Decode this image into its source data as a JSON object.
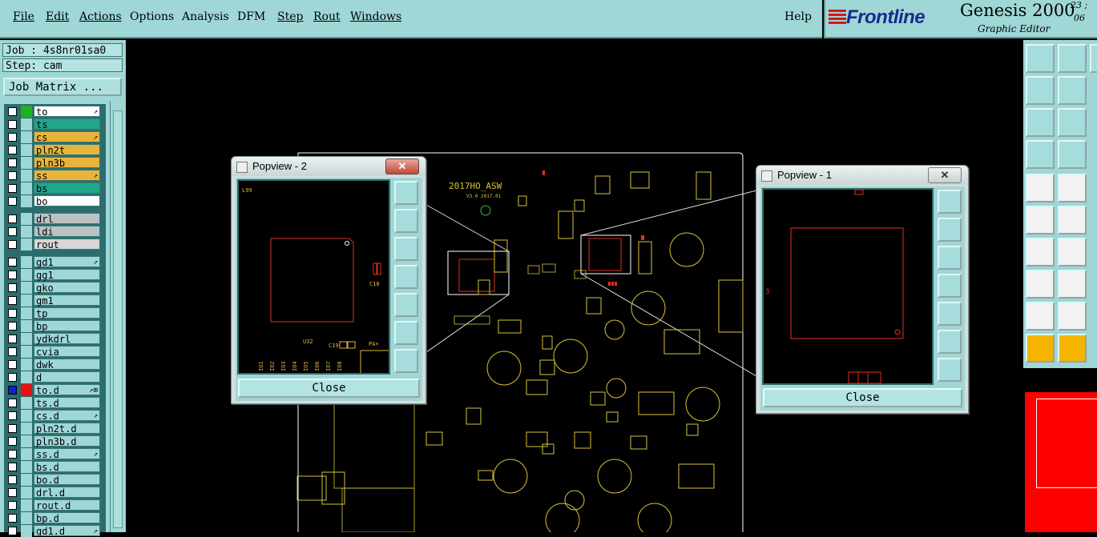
{
  "menu": {
    "items": [
      "File",
      "Edit",
      "Actions",
      "Options",
      "Analysis",
      "DFM",
      "Step",
      "Rout",
      "Windows"
    ],
    "help": "Help"
  },
  "brand": {
    "logo": "Frontline",
    "title": "Genesis 2000",
    "subtitle": "Graphic Editor",
    "clock_line1": "23 ;",
    "clock_line2": "06"
  },
  "job": {
    "job_label": "Job : 4s8nr01sa0",
    "step_label": "Step: cam",
    "matrix_button": "Job Matrix ..."
  },
  "layers": [
    {
      "name": "to",
      "swatch": "#20b020",
      "fill": "#ffffff",
      "mark": "↗"
    },
    {
      "name": "ts",
      "swatch": "#9fd6d6",
      "fill": "#21a68a",
      "mark": ""
    },
    {
      "name": "cs",
      "swatch": "#9fd6d6",
      "fill": "#e8b43a",
      "mark": "↗"
    },
    {
      "name": "pln2t",
      "swatch": "#9fd6d6",
      "fill": "#e8b43a",
      "mark": ""
    },
    {
      "name": "pln3b",
      "swatch": "#9fd6d6",
      "fill": "#e8b43a",
      "mark": ""
    },
    {
      "name": "ss",
      "swatch": "#9fd6d6",
      "fill": "#e8b43a",
      "mark": "↗"
    },
    {
      "name": "bs",
      "swatch": "#9fd6d6",
      "fill": "#21a68a",
      "mark": ""
    },
    {
      "name": "bo",
      "swatch": "#9fd6d6",
      "fill": "#ffffff",
      "mark": ""
    },
    {
      "name": "drl",
      "swatch": "#9fd6d6",
      "fill": "#b9c3c3",
      "mark": ""
    },
    {
      "name": "ldi",
      "swatch": "#9fd6d6",
      "fill": "#b9c3c3",
      "mark": ""
    },
    {
      "name": "rout",
      "swatch": "#9fd6d6",
      "fill": "#d6d6d6",
      "mark": ""
    },
    {
      "name": "gd1",
      "swatch": "#9fd6d6",
      "fill": "#9fd6d6",
      "mark": "↗"
    },
    {
      "name": "gg1",
      "swatch": "#9fd6d6",
      "fill": "#9fd6d6",
      "mark": ""
    },
    {
      "name": "gko",
      "swatch": "#9fd6d6",
      "fill": "#9fd6d6",
      "mark": ""
    },
    {
      "name": "gm1",
      "swatch": "#9fd6d6",
      "fill": "#9fd6d6",
      "mark": ""
    },
    {
      "name": "tp",
      "swatch": "#9fd6d6",
      "fill": "#9fd6d6",
      "mark": ""
    },
    {
      "name": "bp",
      "swatch": "#9fd6d6",
      "fill": "#9fd6d6",
      "mark": ""
    },
    {
      "name": "ydkdrl",
      "swatch": "#9fd6d6",
      "fill": "#9fd6d6",
      "mark": ""
    },
    {
      "name": "cvia",
      "swatch": "#9fd6d6",
      "fill": "#9fd6d6",
      "mark": ""
    },
    {
      "name": "dwk",
      "swatch": "#9fd6d6",
      "fill": "#9fd6d6",
      "mark": ""
    },
    {
      "name": "d",
      "swatch": "#9fd6d6",
      "fill": "#9fd6d6",
      "mark": ""
    },
    {
      "name": "to.d",
      "swatch": "#ee1010",
      "fill": "#9fd6d6",
      "mark": "↗⊞",
      "selected": true
    },
    {
      "name": "ts.d",
      "swatch": "#9fd6d6",
      "fill": "#9fd6d6",
      "mark": ""
    },
    {
      "name": "cs.d",
      "swatch": "#9fd6d6",
      "fill": "#9fd6d6",
      "mark": "↗"
    },
    {
      "name": "pln2t.d",
      "swatch": "#9fd6d6",
      "fill": "#9fd6d6",
      "mark": ""
    },
    {
      "name": "pln3b.d",
      "swatch": "#9fd6d6",
      "fill": "#9fd6d6",
      "mark": ""
    },
    {
      "name": "ss.d",
      "swatch": "#9fd6d6",
      "fill": "#9fd6d6",
      "mark": "↗"
    },
    {
      "name": "bs.d",
      "swatch": "#9fd6d6",
      "fill": "#9fd6d6",
      "mark": ""
    },
    {
      "name": "bo.d",
      "swatch": "#9fd6d6",
      "fill": "#9fd6d6",
      "mark": ""
    },
    {
      "name": "drl.d",
      "swatch": "#9fd6d6",
      "fill": "#9fd6d6",
      "mark": ""
    },
    {
      "name": "rout.d",
      "swatch": "#9fd6d6",
      "fill": "#9fd6d6",
      "mark": ""
    },
    {
      "name": "bp.d",
      "swatch": "#9fd6d6",
      "fill": "#9fd6d6",
      "mark": ""
    },
    {
      "name": "gd1.d",
      "swatch": "#9fd6d6",
      "fill": "#9fd6d6",
      "mark": "↗"
    }
  ],
  "board": {
    "silk_title": "2017HO_ASW",
    "silk_version": "V3.0 2017.01"
  },
  "popview2": {
    "title": "Popview - 2",
    "close": "Close",
    "labels": {
      "l1": "L99",
      "l2": "C18",
      "l3": "U32",
      "l4": "C19",
      "l5": "PA+"
    },
    "pins": [
      "IO1",
      "IO2",
      "IO3",
      "IO4",
      "IO5",
      "IO6",
      "IO7",
      "IO8"
    ]
  },
  "popview1": {
    "title": "Popview - 1",
    "close": "Close",
    "labels": {
      "l1": "3"
    }
  },
  "colors": {
    "panel": "#9fd6d6",
    "trace": "#d8c23a",
    "pad": "#e03020",
    "outline": "#ffffff"
  }
}
